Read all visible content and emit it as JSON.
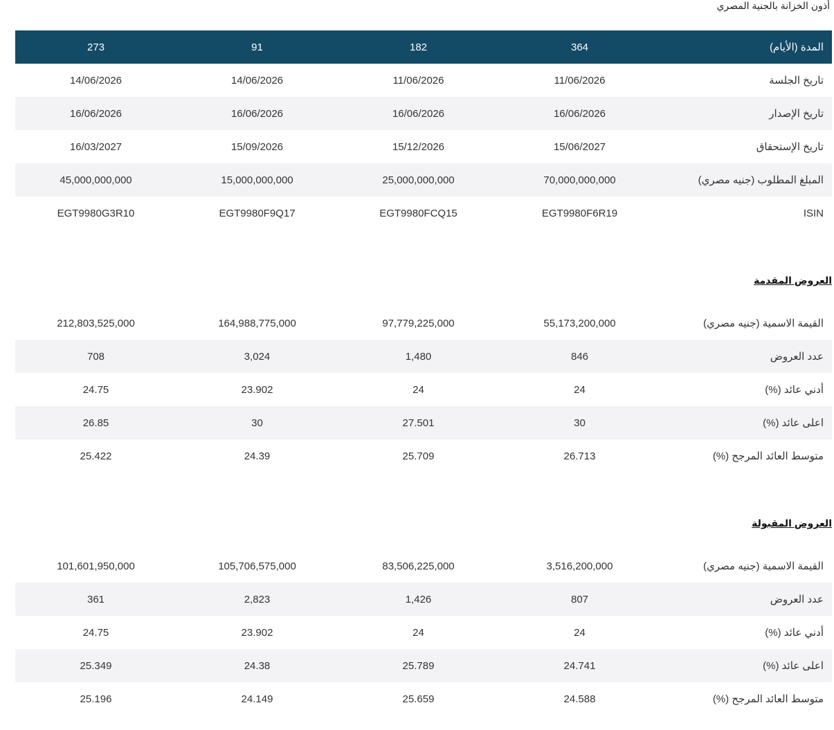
{
  "title": "أذون الخزانة بالجنية المصري",
  "header_color": "#134a66",
  "auction": {
    "header": {
      "label": "المدة (الأيام)",
      "values": [
        "364",
        "182",
        "91",
        "273"
      ]
    },
    "rows": [
      {
        "label": "تاريخ الجلسة",
        "values": [
          "11/06/2026",
          "11/06/2026",
          "14/06/2026",
          "14/06/2026"
        ]
      },
      {
        "label": "تاريخ الإصدار",
        "values": [
          "16/06/2026",
          "16/06/2026",
          "16/06/2026",
          "16/06/2026"
        ]
      },
      {
        "label": "تاريخ الإستحقاق",
        "values": [
          "15/06/2027",
          "15/12/2026",
          "15/09/2026",
          "16/03/2027"
        ]
      },
      {
        "label": "المبلغ المطلوب (جنيه مصري)",
        "values": [
          "70,000,000,000",
          "25,000,000,000",
          "15,000,000,000",
          "45,000,000,000"
        ]
      },
      {
        "label": "ISIN",
        "values": [
          "EGT9980F6R19",
          "EGT9980FCQ15",
          "EGT9980F9Q17",
          "EGT9980G3R10"
        ]
      }
    ]
  },
  "offered": {
    "heading": "العروض المقدمة",
    "rows": [
      {
        "label": "القيمة الاسمية (جنيه مصري)",
        "values": [
          "55,173,200,000",
          "97,779,225,000",
          "164,988,775,000",
          "212,803,525,000"
        ]
      },
      {
        "label": "عدد العروض",
        "values": [
          "846",
          "1,480",
          "3,024",
          "708"
        ]
      },
      {
        "label": "أدني عائد (%)",
        "values": [
          "24",
          "24",
          "23.902",
          "24.75"
        ]
      },
      {
        "label": "اعلى عائد (%)",
        "values": [
          "30",
          "27.501",
          "30",
          "26.85"
        ]
      },
      {
        "label": "متوسط العائد المرجح (%)",
        "values": [
          "26.713",
          "25.709",
          "24.39",
          "25.422"
        ]
      }
    ]
  },
  "accepted": {
    "heading": "العروض المقبولة",
    "rows": [
      {
        "label": "القيمة الاسمية (جنيه مصري)",
        "values": [
          "3,516,200,000",
          "83,506,225,000",
          "105,706,575,000",
          "101,601,950,000"
        ]
      },
      {
        "label": "عدد العروض",
        "values": [
          "807",
          "1,426",
          "2,823",
          "361"
        ]
      },
      {
        "label": "أدني عائد (%)",
        "values": [
          "24",
          "24",
          "23.902",
          "24.75"
        ]
      },
      {
        "label": "اعلى عائد (%)",
        "values": [
          "24.741",
          "25.789",
          "24.38",
          "25.349"
        ]
      },
      {
        "label": "متوسط العائد المرجح (%)",
        "values": [
          "24.588",
          "25.659",
          "24.149",
          "25.196"
        ]
      }
    ]
  }
}
